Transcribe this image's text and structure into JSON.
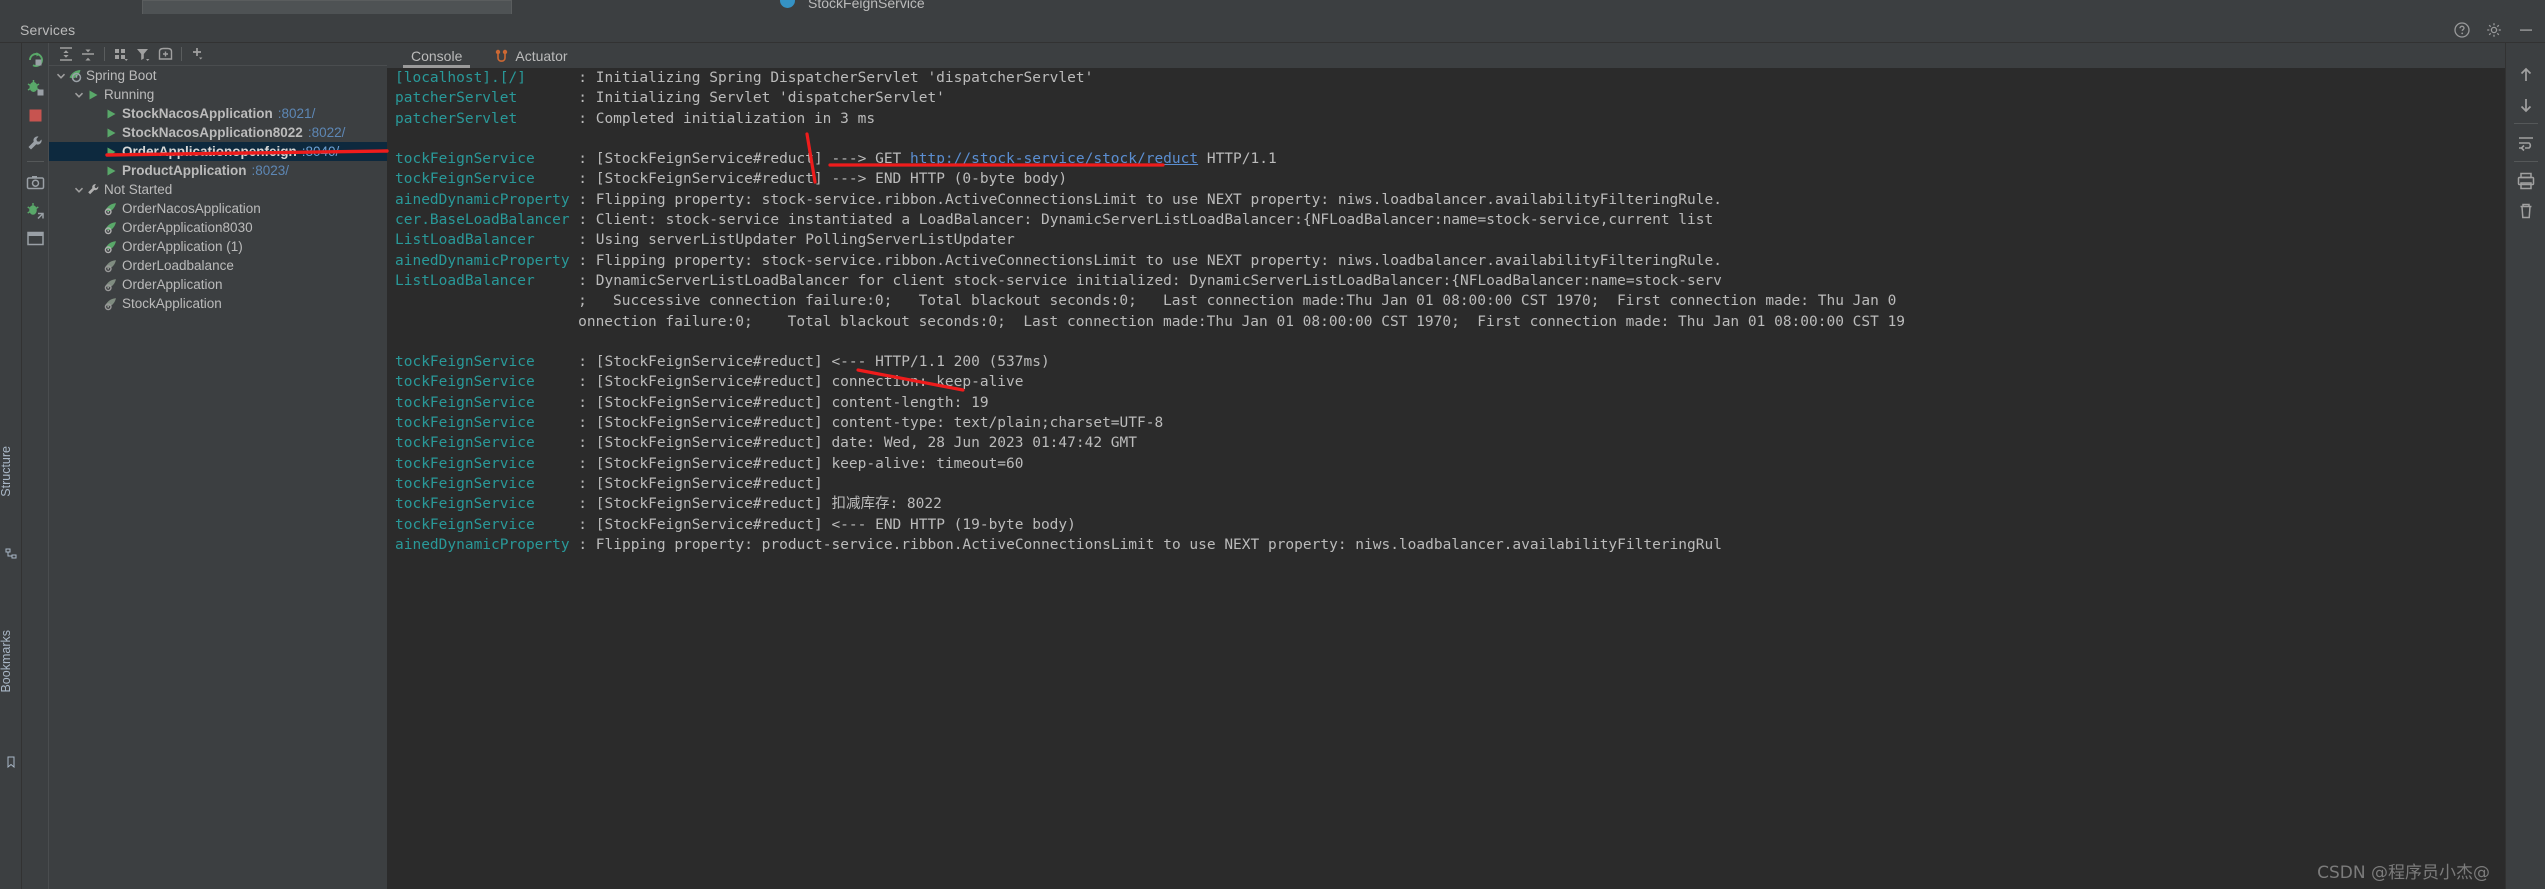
{
  "window": {
    "ghost_tab_title": "StockFeignService",
    "tool_window_title": "Services",
    "header_actions": [
      "help-icon",
      "settings-icon",
      "hide-icon"
    ]
  },
  "left_rail": {
    "structure_label": "Structure",
    "bookmarks_label": "Bookmarks"
  },
  "services_rail": {
    "buttons": [
      "rerun-icon",
      "debug-icon",
      "stop-icon",
      "wrench-icon",
      "camera-icon",
      "debug-attach-icon",
      "layout-icon"
    ]
  },
  "tree_toolbar": {
    "buttons": [
      "expand-all-icon",
      "collapse-all-icon",
      "group-by-icon",
      "filter-icon",
      "add-tab-icon",
      "add-icon"
    ]
  },
  "tree": {
    "nodes": [
      {
        "label": "Spring Boot",
        "port": "",
        "indent": 0,
        "chevron": "down",
        "icon": "spring-boot-icon",
        "bold": false,
        "selected": false
      },
      {
        "label": "Running",
        "port": "",
        "indent": 1,
        "chevron": "down",
        "icon": "run-icon",
        "bold": false,
        "selected": false
      },
      {
        "label": "StockNacosApplication",
        "port": ":8021/",
        "indent": 2,
        "chevron": "",
        "icon": "run-icon",
        "bold": true,
        "selected": false
      },
      {
        "label": "StockNacosApplication8022",
        "port": ":8022/",
        "indent": 2,
        "chevron": "",
        "icon": "run-icon",
        "bold": true,
        "selected": false
      },
      {
        "label": "OrderApplicationopenfeign",
        "port": ":8040/",
        "indent": 2,
        "chevron": "",
        "icon": "run-icon",
        "bold": true,
        "selected": true
      },
      {
        "label": "ProductApplication",
        "port": ":8023/",
        "indent": 2,
        "chevron": "",
        "icon": "run-icon",
        "bold": true,
        "selected": false
      },
      {
        "label": "Not Started",
        "port": "",
        "indent": 1,
        "chevron": "down",
        "icon": "wrench-icon",
        "bold": false,
        "selected": false
      },
      {
        "label": "OrderNacosApplication",
        "port": "",
        "indent": 2,
        "chevron": "",
        "icon": "spring-config-icon",
        "bold": false,
        "selected": false
      },
      {
        "label": "OrderApplication8030",
        "port": "",
        "indent": 2,
        "chevron": "",
        "icon": "spring-config-icon",
        "bold": false,
        "selected": false
      },
      {
        "label": "OrderApplication (1)",
        "port": "",
        "indent": 2,
        "chevron": "",
        "icon": "spring-config-icon",
        "bold": false,
        "selected": false
      },
      {
        "label": "OrderLoadbalance",
        "port": "",
        "indent": 2,
        "chevron": "",
        "icon": "spring-config-gray-icon",
        "bold": false,
        "selected": false
      },
      {
        "label": "OrderApplication",
        "port": "",
        "indent": 2,
        "chevron": "",
        "icon": "spring-config-gray-icon",
        "bold": false,
        "selected": false
      },
      {
        "label": "StockApplication",
        "port": "",
        "indent": 2,
        "chevron": "",
        "icon": "spring-config-gray-icon",
        "bold": false,
        "selected": false
      }
    ]
  },
  "tabs": [
    {
      "label": "Console",
      "icon": "",
      "active": true
    },
    {
      "label": "Actuator",
      "icon": "actuator-icon",
      "active": false
    }
  ],
  "console": {
    "lines": [
      {
        "logger": "[localhost].[/]",
        "msg": ": Initializing Spring DispatcherServlet 'dispatcherServlet'"
      },
      {
        "logger": "patcherServlet",
        "msg": ": Initializing Servlet 'dispatcherServlet'"
      },
      {
        "logger": "patcherServlet",
        "msg": ": Completed initialization in 3 ms"
      },
      {
        "logger": "",
        "msg": ""
      },
      {
        "logger": "tockFeignService",
        "msg": ": [StockFeignService#reduct] ---> GET ",
        "link": "http://stock-service/stock/reduct",
        "msg_after": " HTTP/1.1"
      },
      {
        "logger": "tockFeignService",
        "msg": ": [StockFeignService#reduct] ---> END HTTP (0-byte body)"
      },
      {
        "logger": "ainedDynamicProperty",
        "msg": ": Flipping property: stock-service.ribbon.ActiveConnectionsLimit to use NEXT property: niws.loadbalancer.availabilityFilteringRule."
      },
      {
        "logger": "cer.BaseLoadBalancer",
        "msg": ": Client: stock-service instantiated a LoadBalancer: DynamicServerListLoadBalancer:{NFLoadBalancer:name=stock-service,current list"
      },
      {
        "logger": "ListLoadBalancer",
        "msg": ": Using serverListUpdater PollingServerListUpdater"
      },
      {
        "logger": "ainedDynamicProperty",
        "msg": ": Flipping property: stock-service.ribbon.ActiveConnectionsLimit to use NEXT property: niws.loadbalancer.availabilityFilteringRule."
      },
      {
        "logger": "ListLoadBalancer",
        "msg": ": DynamicServerListLoadBalancer for client stock-service initialized: DynamicServerListLoadBalancer:{NFLoadBalancer:name=stock-serv"
      },
      {
        "logger": "",
        "msg": ";   Successive connection failure:0;   Total blackout seconds:0;   Last connection made:Thu Jan 01 08:00:00 CST 1970;  First connection made: Thu Jan 0"
      },
      {
        "logger": "",
        "msg": "onnection failure:0;    Total blackout seconds:0;  Last connection made:Thu Jan 01 08:00:00 CST 1970;  First connection made: Thu Jan 01 08:00:00 CST 19"
      },
      {
        "logger": "",
        "msg": ""
      },
      {
        "logger": "tockFeignService",
        "msg": ": [StockFeignService#reduct] <--- HTTP/1.1 200 (537ms)"
      },
      {
        "logger": "tockFeignService",
        "msg": ": [StockFeignService#reduct] connection: keep-alive"
      },
      {
        "logger": "tockFeignService",
        "msg": ": [StockFeignService#reduct] content-length: 19"
      },
      {
        "logger": "tockFeignService",
        "msg": ": [StockFeignService#reduct] content-type: text/plain;charset=UTF-8"
      },
      {
        "logger": "tockFeignService",
        "msg": ": [StockFeignService#reduct] date: Wed, 28 Jun 2023 01:47:42 GMT"
      },
      {
        "logger": "tockFeignService",
        "msg": ": [StockFeignService#reduct] keep-alive: timeout=60"
      },
      {
        "logger": "tockFeignService",
        "msg": ": [StockFeignService#reduct]"
      },
      {
        "logger": "tockFeignService",
        "msg": ": [StockFeignService#reduct] 扣减库存: 8022"
      },
      {
        "logger": "tockFeignService",
        "msg": ": [StockFeignService#reduct] <--- END HTTP (19-byte body)"
      },
      {
        "logger": "ainedDynamicProperty",
        "msg": ": Flipping property: product-service.ribbon.ActiveConnectionsLimit to use NEXT property: niws.loadbalancer.availabilityFilteringRul"
      }
    ]
  },
  "right_actions": {
    "buttons": [
      "scroll-up-icon",
      "scroll-down-icon",
      "soft-wrap-icon",
      "print-icon",
      "trash-icon"
    ]
  },
  "annotations": {
    "color": "#ee1c1c",
    "items": [
      "underline-selected-service-row",
      "arrow-to-get-request",
      "underline-request-url",
      "underline-http-200-response"
    ]
  },
  "watermark": "CSDN @程序员小杰@"
}
